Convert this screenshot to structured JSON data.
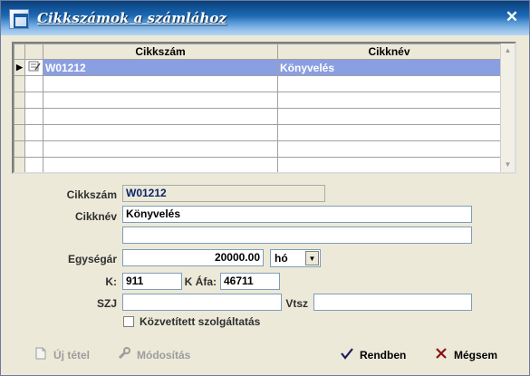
{
  "window": {
    "title": "Cikkszámok a számlához",
    "close_glyph": "✕"
  },
  "grid": {
    "columns": [
      "Cikkszám",
      "Cikknév"
    ],
    "rows": [
      [
        "W01212",
        "Könyvelés"
      ],
      [
        "",
        ""
      ],
      [
        "",
        ""
      ],
      [
        "",
        ""
      ],
      [
        "",
        ""
      ],
      [
        "",
        ""
      ],
      [
        "",
        ""
      ]
    ],
    "selected_row": 0
  },
  "form": {
    "cikkszam_label": "Cikkszám",
    "cikkszam_value": "W01212",
    "cikknev_label": "Cikknév",
    "cikknev_value": "Könyvelés",
    "cikknev2_value": "",
    "egysegar_label": "Egységár",
    "egysegar_value": "20000.00",
    "unit_value": "hó",
    "k_label": "K:",
    "k_value": "911",
    "kafa_label": "K Áfa:",
    "kafa_value": "46711",
    "szj_label": "SZJ",
    "szj_value": "",
    "vtsz_label": "Vtsz",
    "vtsz_value": "",
    "kozvetitett_label": "Közvetített szolgáltatás",
    "kozvetitett_checked": false
  },
  "buttons": {
    "uj_tetel": "Új tétel",
    "modositas": "Módosítás",
    "rendben": "Rendben",
    "megsem": "Mégsem"
  },
  "icons": {
    "title": "window-icon",
    "uj_tetel": "new-document-icon",
    "modositas": "wrench-icon",
    "rendben": "checkmark-icon",
    "megsem": "x-icon"
  }
}
